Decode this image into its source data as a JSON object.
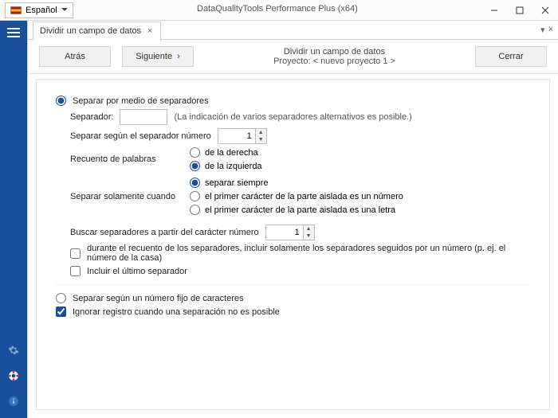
{
  "titlebar": {
    "language_label": "Español",
    "app_title": "DataQualityTools Performance Plus (x64)"
  },
  "tab": {
    "title": "Dividir un campo de datos"
  },
  "toolbar": {
    "back_label": "Atrás",
    "next_label": "Siguiente",
    "close_label": "Cerrar",
    "header_line1": "Dividir un campo de datos",
    "header_line2": "Proyecto: < nuevo proyecto 1 >"
  },
  "form": {
    "mode_separators": "Separar por medio de separadores",
    "separator_label": "Separador:",
    "separator_value": "",
    "separator_hint": "(La indicación de varios separadores alternativos es posible.)",
    "sep_index_label": "Separar según el separador número",
    "sep_index_value": "1",
    "wordcount_label": "Recuento de palabras",
    "wordcount_right": "de la derecha",
    "wordcount_left": "de la izquierda",
    "onlywhen_label": "Separar solamente cuando",
    "onlywhen_always": "separar siempre",
    "onlywhen_firstnum": "el primer carácter de la parte aislada es un número",
    "onlywhen_firstletter": "el primer carácter de la parte aislada es una letra",
    "fromchar_label": "Buscar separadores a partir del carácter número",
    "fromchar_value": "1",
    "chk_followed_number": "durante el recuento de los separadores, incluir solamente los separadores seguidos por un número  (p. ej. el número de la casa)",
    "chk_include_last": "Incluir el último separador",
    "mode_fixed": "Separar según un número fijo de caracteres",
    "chk_ignore": "Ignorar registro cuando una separación no es posible"
  }
}
